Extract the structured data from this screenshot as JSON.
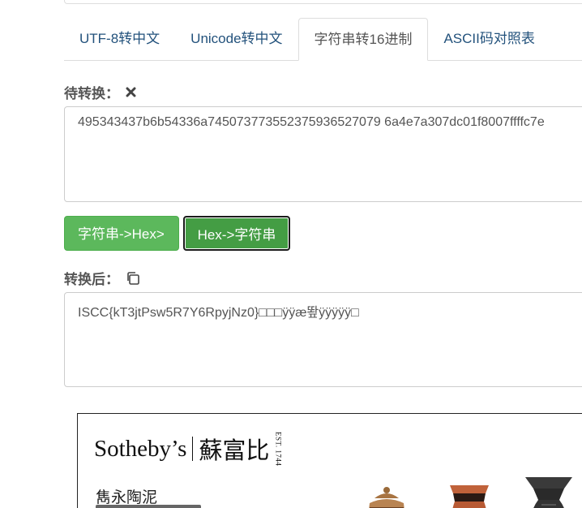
{
  "tabs": [
    {
      "label": "UTF-8转中文",
      "active": false
    },
    {
      "label": "Unicode转中文",
      "active": false
    },
    {
      "label": "字符串转16进制",
      "active": true
    },
    {
      "label": "ASCII码对照表",
      "active": false
    }
  ],
  "input": {
    "label": "待转换：",
    "clear_icon": "close-icon",
    "value": "495343437b6b54336a745073773552375936527079 6a4e7a307dc01f8007ffffc7e"
  },
  "buttons": {
    "to_hex": "字符串->Hex>",
    "to_string": "Hex->字符串"
  },
  "output": {
    "label": "转换后：",
    "copy_icon": "copy-icon",
    "value": "ISCC{kT3jtPsw5R7Y6RpyjNz0}□□□ÿÿæ뙆ÿÿÿÿÿ□"
  },
  "ad": {
    "brand_en": "Sotheby’s",
    "brand_zh": "蘇富比",
    "est": "EST. 1744",
    "subtitle": "雋永陶泥"
  },
  "colors": {
    "tab_link": "#23527c",
    "btn_green": "#5cb85c",
    "btn_green_active": "#449d44"
  }
}
